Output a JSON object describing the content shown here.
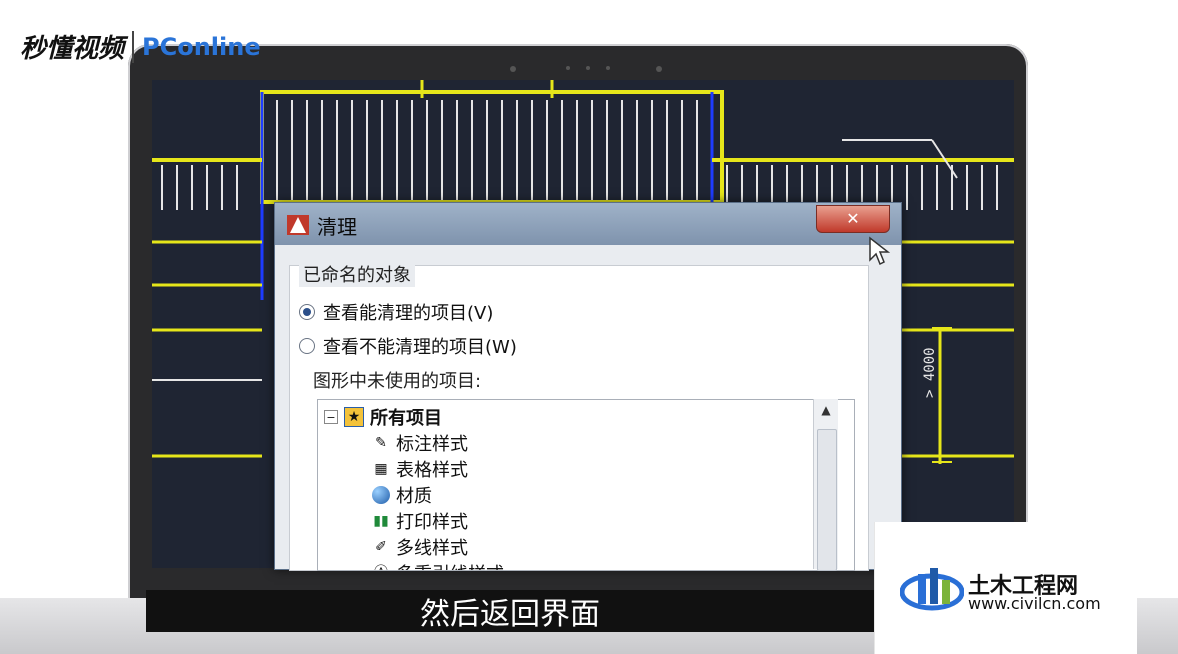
{
  "overlay": {
    "brand_left": "秒懂视频",
    "brand_right": "PConline",
    "subtitle": "然后返回界面",
    "watermark_title": "土木工程网",
    "watermark_url": "www.civilcn.com"
  },
  "dialog": {
    "title": "清理",
    "close_label": "✕",
    "group_label": "已命名的对象",
    "radio_options": [
      {
        "label": "查看能清理的项目(V)",
        "selected": true
      },
      {
        "label": "查看不能清理的项目(W)",
        "selected": false
      }
    ],
    "unused_label": "图形中未使用的项目:",
    "tree": {
      "root_label": "所有项目",
      "items": [
        {
          "label": "标注样式",
          "icon": "dimension-style-icon"
        },
        {
          "label": "表格样式",
          "icon": "table-style-icon"
        },
        {
          "label": "材质",
          "icon": "material-icon"
        },
        {
          "label": "打印样式",
          "icon": "plot-style-icon"
        },
        {
          "label": "多线样式",
          "icon": "multiline-style-icon"
        },
        {
          "label": "多重引线样式",
          "icon": "mleader-style-icon"
        }
      ]
    }
  },
  "cad": {
    "annotation_text": "> 4000"
  },
  "colors": {
    "cad_bg": "#1f2533",
    "cad_yellow": "#e6e61a",
    "cad_blue": "#1e3cff",
    "cad_white": "#e6e6e6"
  }
}
